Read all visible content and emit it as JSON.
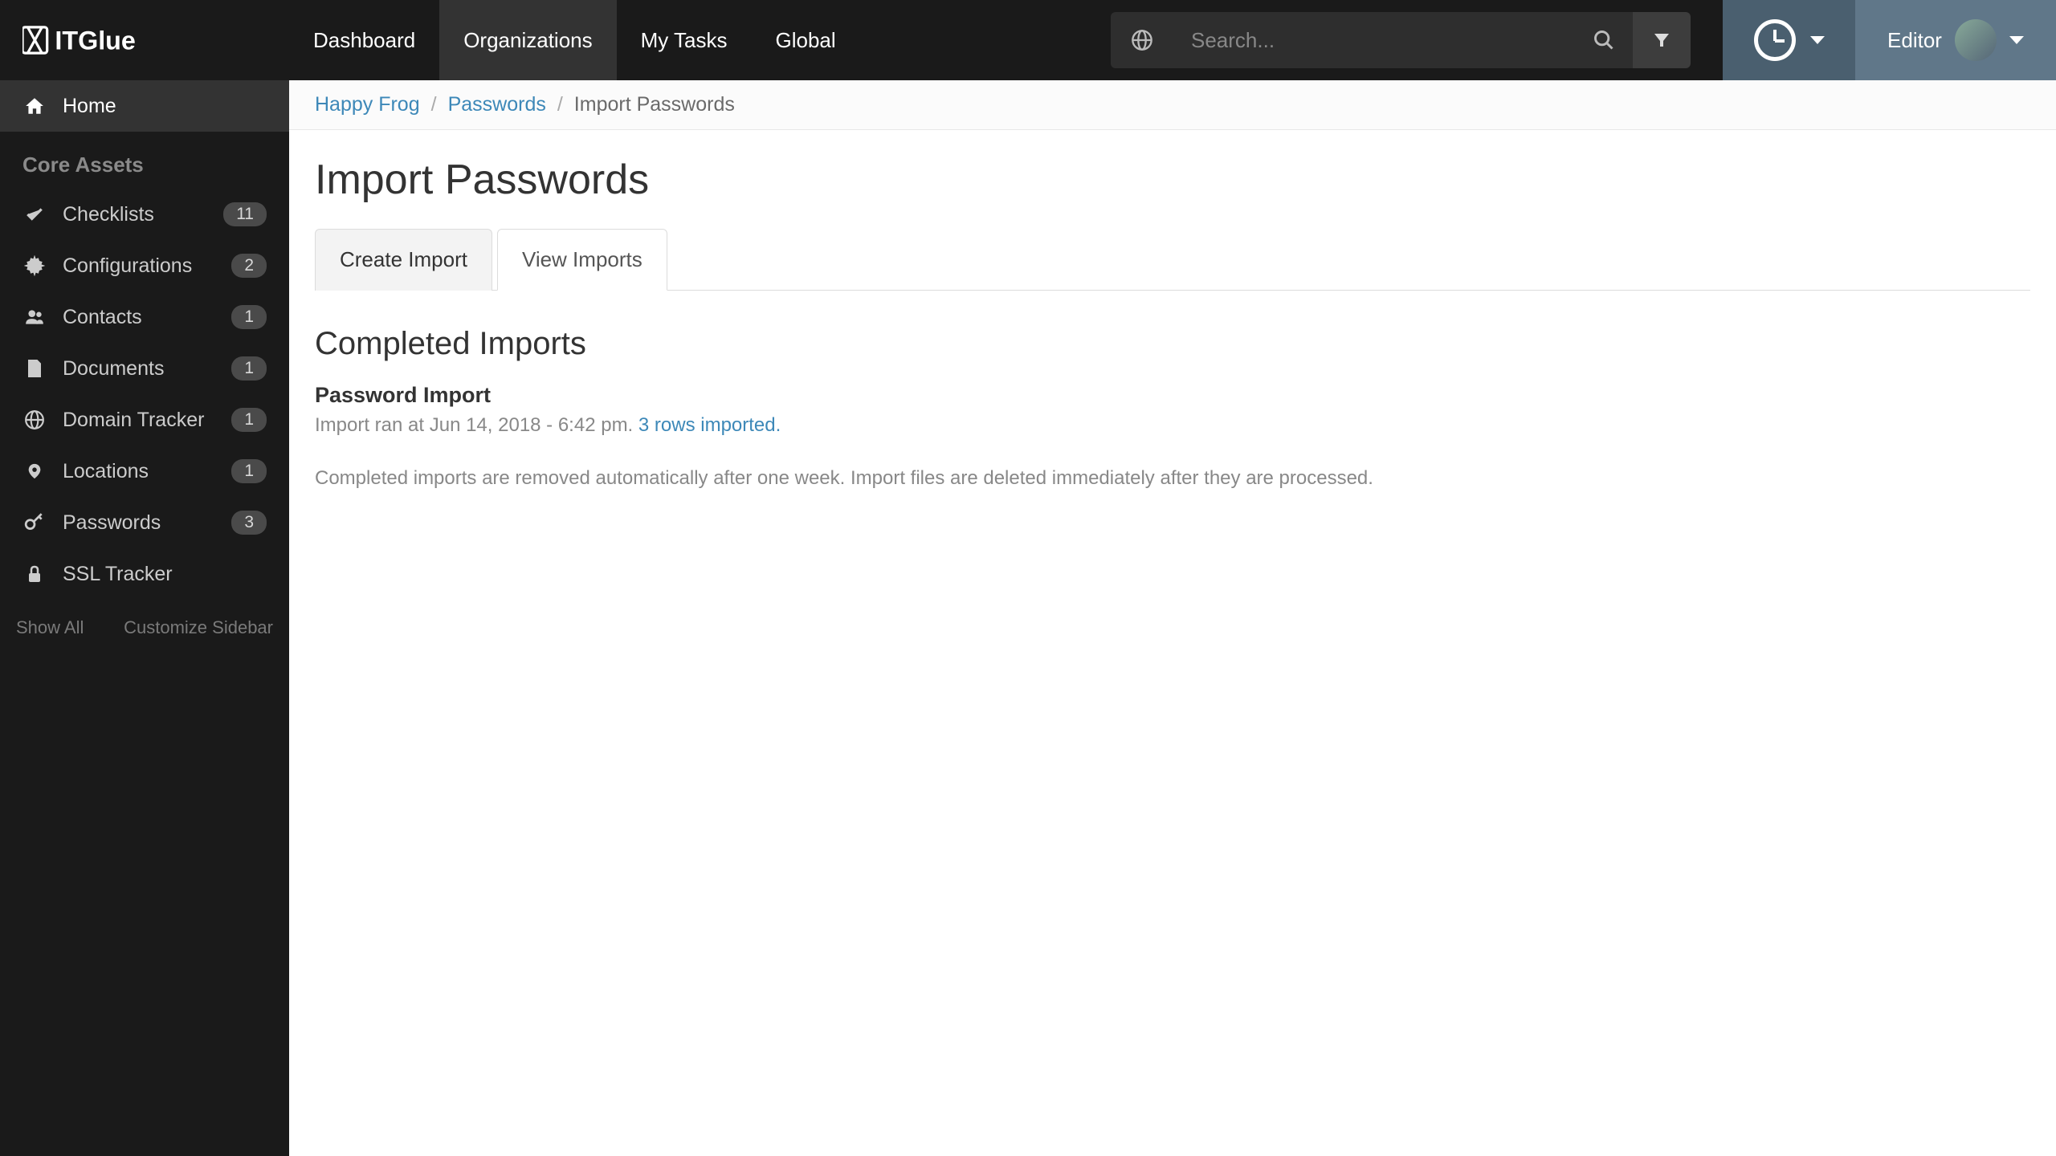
{
  "brand": "ITGlue",
  "nav": {
    "dashboard": "Dashboard",
    "organizations": "Organizations",
    "mytasks": "My Tasks",
    "global": "Global"
  },
  "search": {
    "placeholder": "Search..."
  },
  "user": {
    "role": "Editor"
  },
  "sidebar": {
    "home": "Home",
    "heading": "Core Assets",
    "items": [
      {
        "label": "Checklists",
        "badge": "11"
      },
      {
        "label": "Configurations",
        "badge": "2"
      },
      {
        "label": "Contacts",
        "badge": "1"
      },
      {
        "label": "Documents",
        "badge": "1"
      },
      {
        "label": "Domain Tracker",
        "badge": "1"
      },
      {
        "label": "Locations",
        "badge": "1"
      },
      {
        "label": "Passwords",
        "badge": "3"
      },
      {
        "label": "SSL Tracker",
        "badge": ""
      }
    ],
    "show_all": "Show All",
    "customize": "Customize Sidebar"
  },
  "breadcrumb": {
    "org": "Happy Frog",
    "section": "Passwords",
    "current": "Import Passwords"
  },
  "page": {
    "title": "Import Passwords",
    "tab_create": "Create Import",
    "tab_view": "View Imports",
    "section": "Completed Imports",
    "import_title": "Password Import",
    "import_meta_prefix": "Import ran at Jun 14, 2018 - 6:42 pm. ",
    "import_meta_link": "3 rows imported.",
    "note": "Completed imports are removed automatically after one week. Import files are deleted immediately after they are processed."
  }
}
